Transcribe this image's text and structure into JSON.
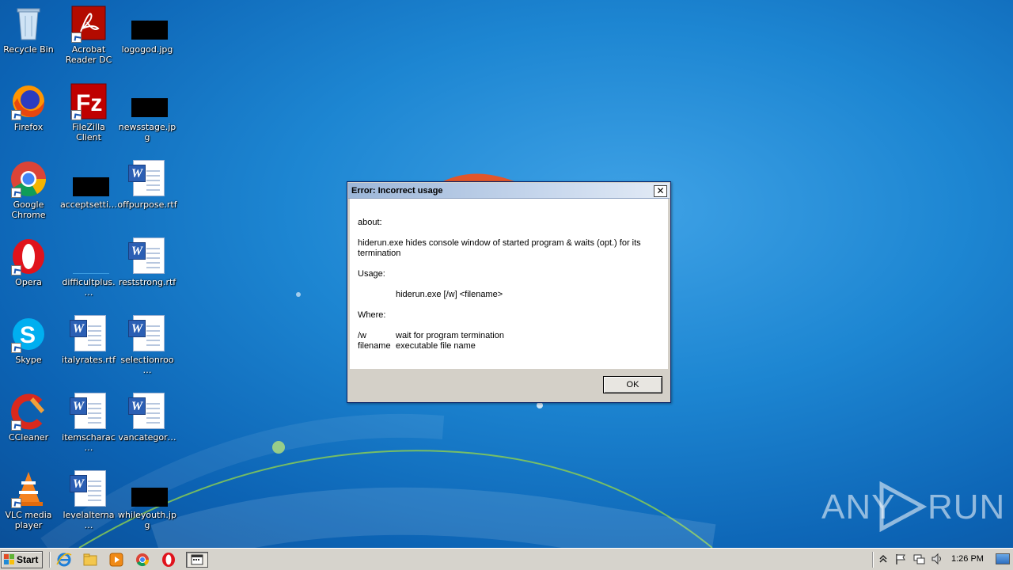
{
  "desktop_icons": [
    {
      "label": "Recycle Bin",
      "icon": "recycle-bin-icon"
    },
    {
      "label": "Acrobat Reader DC",
      "icon": "acrobat-reader-icon"
    },
    {
      "label": "logogod.jpg",
      "icon": "image-file-icon"
    },
    {
      "label": "Firefox",
      "icon": "firefox-icon"
    },
    {
      "label": "FileZilla Client",
      "icon": "filezilla-icon"
    },
    {
      "label": "newsstage.jpg",
      "icon": "image-file-icon"
    },
    {
      "label": "Google Chrome",
      "icon": "chrome-icon"
    },
    {
      "label": "acceptsetti…",
      "icon": "file-icon"
    },
    {
      "label": "offpurpose.rtf",
      "icon": "word-document-icon"
    },
    {
      "label": "Opera",
      "icon": "opera-icon"
    },
    {
      "label": "difficultplus.…",
      "icon": "file-icon"
    },
    {
      "label": "reststrong.rtf",
      "icon": "word-document-icon"
    },
    {
      "label": "Skype",
      "icon": "skype-icon"
    },
    {
      "label": "italyrates.rtf",
      "icon": "word-document-icon"
    },
    {
      "label": "selectionroo…",
      "icon": "word-document-icon"
    },
    {
      "label": "CCleaner",
      "icon": "ccleaner-icon"
    },
    {
      "label": "itemscharac…",
      "icon": "word-document-icon"
    },
    {
      "label": "vancategor…",
      "icon": "word-document-icon"
    },
    {
      "label": "VLC media player",
      "icon": "vlc-icon"
    },
    {
      "label": "levelalterna…",
      "icon": "word-document-icon"
    },
    {
      "label": "whileyouth.jpg",
      "icon": "image-file-icon"
    }
  ],
  "dialog": {
    "title": "Error: Incorrect usage",
    "close_glyph": "✕",
    "about": "about:",
    "description": "hiderun.exe hides console window of started program & waits (opt.) for its termination",
    "usage_label": "Usage:",
    "usage_line": "hiderun.exe [/w] <filename>",
    "where_label": "Where:",
    "options": [
      {
        "flag": "/w",
        "desc": "wait for program termination"
      },
      {
        "flag": "filename",
        "desc": "executable file name"
      }
    ],
    "ok_label": "OK"
  },
  "watermark": {
    "left": "ANY",
    "right": "RUN"
  },
  "taskbar": {
    "start_label": "Start",
    "pinned": [
      "internet-explorer-icon",
      "file-explorer-icon",
      "media-player-icon",
      "chrome-icon",
      "opera-icon",
      "console-window-icon"
    ],
    "clock": "1:26 PM"
  }
}
